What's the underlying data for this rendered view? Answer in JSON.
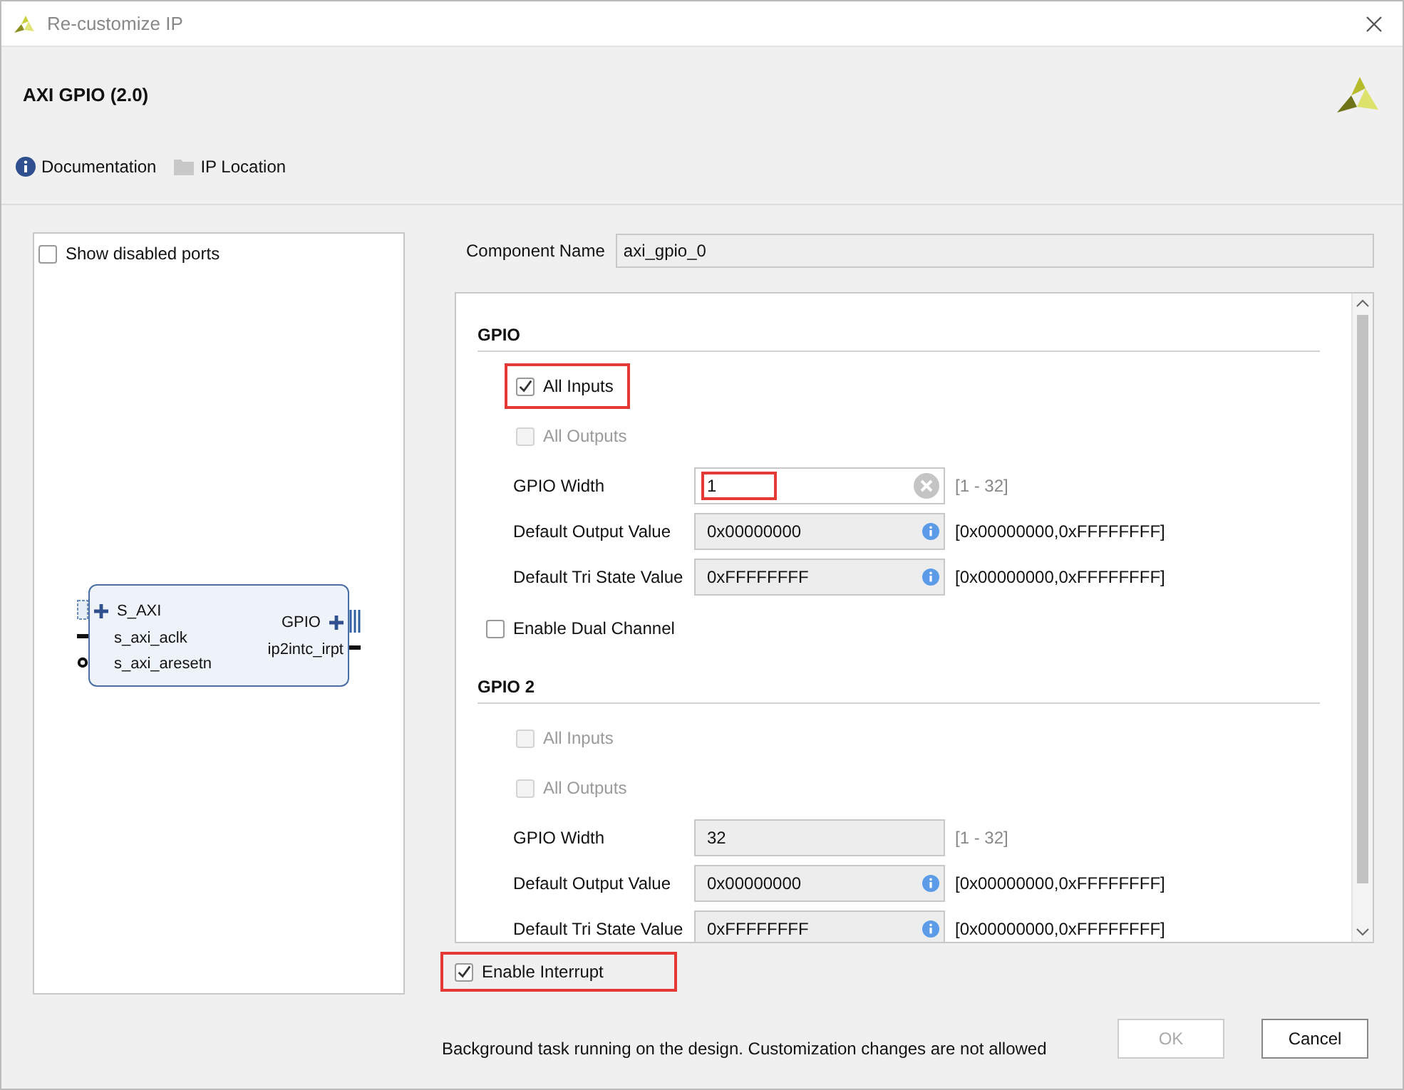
{
  "window": {
    "title": "Re-customize IP"
  },
  "header": {
    "title": "AXI GPIO (2.0)"
  },
  "links": [
    {
      "label": "Documentation",
      "kind": "info"
    },
    {
      "label": "IP Location",
      "kind": "folder"
    }
  ],
  "symbol_panel": {
    "show_disabled_ports": {
      "label": "Show disabled ports",
      "checked": false
    },
    "left_ports": [
      {
        "label": "S_AXI",
        "kind": "bus"
      },
      {
        "label": "s_axi_aclk",
        "kind": "clock"
      },
      {
        "label": "s_axi_aresetn",
        "kind": "reset"
      }
    ],
    "right_ports": [
      {
        "label": "GPIO",
        "kind": "bus"
      },
      {
        "label": "ip2intc_irpt",
        "kind": "wire"
      }
    ]
  },
  "component_name": {
    "label": "Component Name",
    "value": "axi_gpio_0"
  },
  "sections": [
    {
      "title": "GPIO",
      "rows": [
        {
          "kind": "checkbox",
          "label": "All Inputs",
          "checked": true,
          "disabled": false,
          "highlighted": true
        },
        {
          "kind": "checkbox",
          "label": "All Outputs",
          "checked": false,
          "disabled": true,
          "highlighted": false
        },
        {
          "kind": "number",
          "label": "GPIO Width",
          "value": "1",
          "disabled": false,
          "highlighted": true,
          "clearable": true,
          "range": "[1 - 32]"
        },
        {
          "kind": "hex",
          "label": "Default Output Value",
          "value": "0x00000000",
          "disabled": true,
          "highlighted": false,
          "range": "[0x00000000,0xFFFFFFFF]"
        },
        {
          "kind": "hex",
          "label": "Default Tri State Value",
          "value": "0xFFFFFFFF",
          "disabled": true,
          "highlighted": false,
          "range": "[0x00000000,0xFFFFFFFF]"
        },
        {
          "kind": "toggle",
          "label": "Enable Dual Channel",
          "checked": false,
          "disabled": false,
          "highlighted": false
        }
      ]
    },
    {
      "title": "GPIO 2",
      "rows": [
        {
          "kind": "checkbox",
          "label": "All Inputs",
          "checked": false,
          "disabled": true,
          "highlighted": false
        },
        {
          "kind": "checkbox",
          "label": "All Outputs",
          "checked": false,
          "disabled": true,
          "highlighted": false
        },
        {
          "kind": "number",
          "label": "GPIO Width",
          "value": "32",
          "disabled": true,
          "highlighted": false,
          "clearable": false,
          "range": "[1 - 32]"
        },
        {
          "kind": "hex",
          "label": "Default Output Value",
          "value": "0x00000000",
          "disabled": true,
          "highlighted": false,
          "range": "[0x00000000,0xFFFFFFFF]"
        },
        {
          "kind": "hex",
          "label": "Default Tri State Value",
          "value": "0xFFFFFFFF",
          "disabled": true,
          "highlighted": false,
          "range": "[0x00000000,0xFFFFFFFF]"
        }
      ]
    }
  ],
  "interrupt": {
    "label": "Enable Interrupt",
    "checked": true,
    "highlighted": true
  },
  "status_message": "Background task running on the design. Customization changes are not allowed",
  "buttons": [
    {
      "label": "OK",
      "disabled": true
    },
    {
      "label": "Cancel",
      "disabled": false
    }
  ]
}
